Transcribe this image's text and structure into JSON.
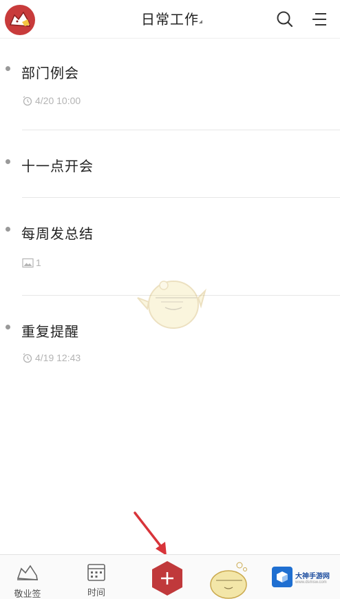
{
  "header": {
    "title": "日常工作"
  },
  "tasks": [
    {
      "title": "部门例会",
      "meta_icon": "alarm-icon",
      "meta": "4/20 10:00"
    },
    {
      "title": "十一点开会"
    },
    {
      "title": "每周发总结",
      "meta_icon": "image-icon",
      "meta": "1"
    },
    {
      "title": "重复提醒",
      "meta_icon": "alarm-icon",
      "meta": "4/19 12:43"
    }
  ],
  "bottom_nav": {
    "notes_label": "敬业签",
    "time_label": "时间",
    "add_icon": "plus-icon"
  },
  "watermark": {
    "title": "大神手游网",
    "url": "www.dsmsw.com"
  },
  "colors": {
    "accent": "#c0393b",
    "text": "#222222",
    "meta": "#b3b3b3"
  }
}
